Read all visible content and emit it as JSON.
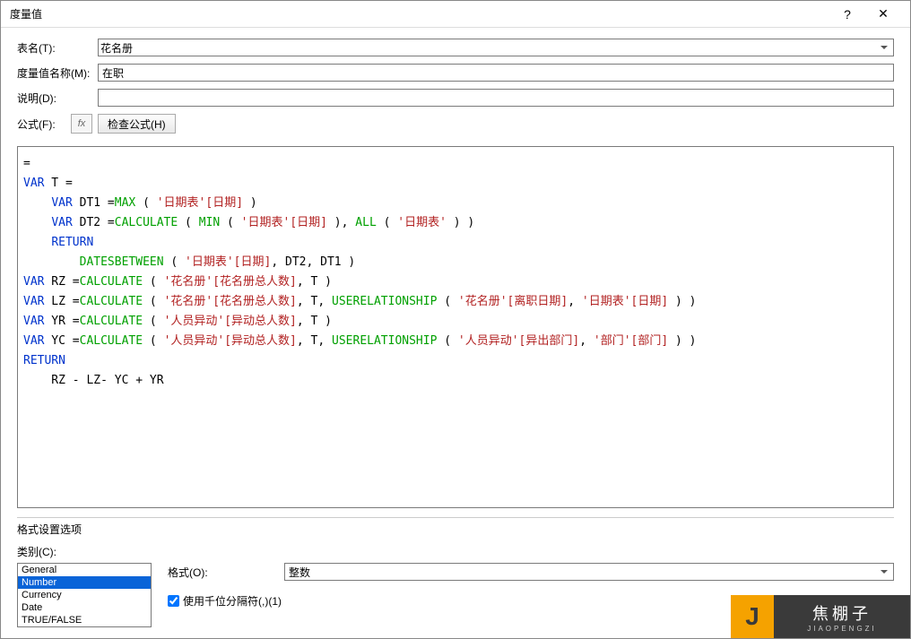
{
  "titlebar": {
    "title": "度量值",
    "help": "?",
    "close": "✕"
  },
  "labels": {
    "tableName": "表名(T):",
    "measureName": "度量值名称(M):",
    "description": "说明(D):",
    "formula": "公式(F):",
    "fx": "fx",
    "checkFormula": "检查公式(H)",
    "formatOptions": "格式设置选项",
    "category": "类别(C):",
    "format": "格式(O):",
    "thousandSep": "使用千位分隔符(,)(1)"
  },
  "fields": {
    "tableName": "花名册",
    "measureName": "在职",
    "description": ""
  },
  "categories": [
    "General",
    "Number",
    "Currency",
    "Date",
    "TRUE/FALSE"
  ],
  "selectedCategory": "Number",
  "formatValue": "整数",
  "thousandSepChecked": true,
  "formula": {
    "tokens": [
      [
        {
          "t": "=",
          "c": ""
        }
      ],
      [
        {
          "t": "VAR",
          "c": "kw"
        },
        {
          "t": " T =",
          "c": ""
        }
      ],
      [
        {
          "t": "    ",
          "c": ""
        },
        {
          "t": "VAR",
          "c": "kw"
        },
        {
          "t": " DT1 =",
          "c": ""
        },
        {
          "t": "MAX",
          "c": "fn"
        },
        {
          "t": " ( ",
          "c": ""
        },
        {
          "t": "'日期表'[日期]",
          "c": "str"
        },
        {
          "t": " )",
          "c": ""
        }
      ],
      [
        {
          "t": "    ",
          "c": ""
        },
        {
          "t": "VAR",
          "c": "kw"
        },
        {
          "t": " DT2 =",
          "c": ""
        },
        {
          "t": "CALCULATE",
          "c": "fn"
        },
        {
          "t": " ( ",
          "c": ""
        },
        {
          "t": "MIN",
          "c": "fn"
        },
        {
          "t": " ( ",
          "c": ""
        },
        {
          "t": "'日期表'[日期]",
          "c": "str"
        },
        {
          "t": " ), ",
          "c": ""
        },
        {
          "t": "ALL",
          "c": "fn"
        },
        {
          "t": " ( ",
          "c": ""
        },
        {
          "t": "'日期表'",
          "c": "str"
        },
        {
          "t": " ) )",
          "c": ""
        }
      ],
      [
        {
          "t": "    ",
          "c": ""
        },
        {
          "t": "RETURN",
          "c": "kw"
        }
      ],
      [
        {
          "t": "        ",
          "c": ""
        },
        {
          "t": "DATESBETWEEN",
          "c": "fn"
        },
        {
          "t": " ( ",
          "c": ""
        },
        {
          "t": "'日期表'[日期]",
          "c": "str"
        },
        {
          "t": ", DT2, DT1 )",
          "c": ""
        }
      ],
      [
        {
          "t": "VAR",
          "c": "kw"
        },
        {
          "t": " RZ =",
          "c": ""
        },
        {
          "t": "CALCULATE",
          "c": "fn"
        },
        {
          "t": " ( ",
          "c": ""
        },
        {
          "t": "'花名册'[花名册总人数]",
          "c": "str"
        },
        {
          "t": ", T )",
          "c": ""
        }
      ],
      [
        {
          "t": "VAR",
          "c": "kw"
        },
        {
          "t": " LZ =",
          "c": ""
        },
        {
          "t": "CALCULATE",
          "c": "fn"
        },
        {
          "t": " ( ",
          "c": ""
        },
        {
          "t": "'花名册'[花名册总人数]",
          "c": "str"
        },
        {
          "t": ", T, ",
          "c": ""
        },
        {
          "t": "USERELATIONSHIP",
          "c": "fn"
        },
        {
          "t": " ( ",
          "c": ""
        },
        {
          "t": "'花名册'[离职日期]",
          "c": "str"
        },
        {
          "t": ", ",
          "c": ""
        },
        {
          "t": "'日期表'[日期]",
          "c": "str"
        },
        {
          "t": " ) )",
          "c": ""
        }
      ],
      [
        {
          "t": "VAR",
          "c": "kw"
        },
        {
          "t": " YR =",
          "c": ""
        },
        {
          "t": "CALCULATE",
          "c": "fn"
        },
        {
          "t": " ( ",
          "c": ""
        },
        {
          "t": "'人员异动'[异动总人数]",
          "c": "str"
        },
        {
          "t": ", T )",
          "c": ""
        }
      ],
      [
        {
          "t": "VAR",
          "c": "kw"
        },
        {
          "t": " YC =",
          "c": ""
        },
        {
          "t": "CALCULATE",
          "c": "fn"
        },
        {
          "t": " ( ",
          "c": ""
        },
        {
          "t": "'人员异动'[异动总人数]",
          "c": "str"
        },
        {
          "t": ", T, ",
          "c": ""
        },
        {
          "t": "USERELATIONSHIP",
          "c": "fn"
        },
        {
          "t": " ( ",
          "c": ""
        },
        {
          "t": "'人员异动'[异出部门]",
          "c": "str"
        },
        {
          "t": ", ",
          "c": ""
        },
        {
          "t": "'部门'[部门]",
          "c": "str"
        },
        {
          "t": " ) )",
          "c": ""
        }
      ],
      [
        {
          "t": "RETURN",
          "c": "kw"
        }
      ],
      [
        {
          "t": "    RZ - LZ- YC + YR",
          "c": ""
        }
      ]
    ]
  },
  "logo": {
    "letter": "J",
    "cn": "焦棚子",
    "en": "JIAOPENGZI"
  }
}
